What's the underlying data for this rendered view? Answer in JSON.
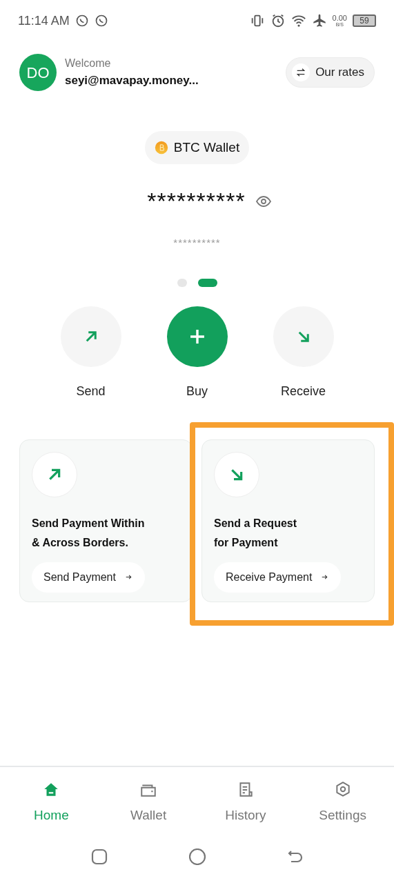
{
  "status_bar": {
    "time": "11:14 AM",
    "net_speed": "0.00",
    "net_unit": "B/S",
    "battery": "59"
  },
  "header": {
    "avatar_initials": "DO",
    "greeting": "Welcome",
    "email": "seyi@mavapay.money...",
    "rates_button": "Our rates"
  },
  "wallet": {
    "label": "BTC Wallet"
  },
  "balance": {
    "main": "**********",
    "secondary": "**********"
  },
  "pages": [
    {
      "selected": false
    },
    {
      "selected": true
    }
  ],
  "actions": [
    {
      "kind": "send",
      "label": "Send"
    },
    {
      "kind": "buy",
      "label": "Buy"
    },
    {
      "kind": "receive",
      "label": "Receive"
    }
  ],
  "cards": [
    {
      "kind": "send",
      "title": "Send Payment Within\n& Across Borders.",
      "button": "Send Payment",
      "highlighted": false
    },
    {
      "kind": "receive",
      "title": "Send a Request\nfor Payment",
      "button": "Receive Payment",
      "highlighted": true
    }
  ],
  "nav": [
    {
      "kind": "home",
      "label": "Home",
      "selected": true
    },
    {
      "kind": "wallet",
      "label": "Wallet",
      "selected": false
    },
    {
      "kind": "history",
      "label": "History",
      "selected": false
    },
    {
      "kind": "settings",
      "label": "Settings",
      "selected": false
    }
  ]
}
